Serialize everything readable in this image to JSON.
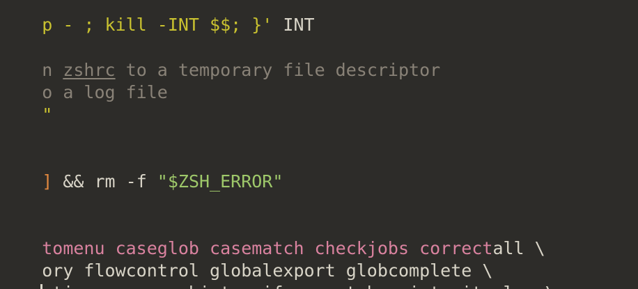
{
  "editor": {
    "lines": {
      "l1_part1": "p - ; kill -INT $$; }'",
      "l1_part2": " INT",
      "l2_part1": "n ",
      "l2_link": "zshrc",
      "l2_part2": " to a temporary file descriptor",
      "l3": "o a log file",
      "l4": "\"",
      "l5_bracket": "]",
      "l5_mid": " && rm -f ",
      "l5_string": "\"$ZSH_ERROR\"",
      "l6_opts": "tomenu caseglob casematch checkjobs correct",
      "l6_rest": "all \\",
      "l7": "ory flowcontrol globalexport globcomplete \\",
      "l8": "stignorespace histverify nomatch printexitvalue \\"
    }
  }
}
